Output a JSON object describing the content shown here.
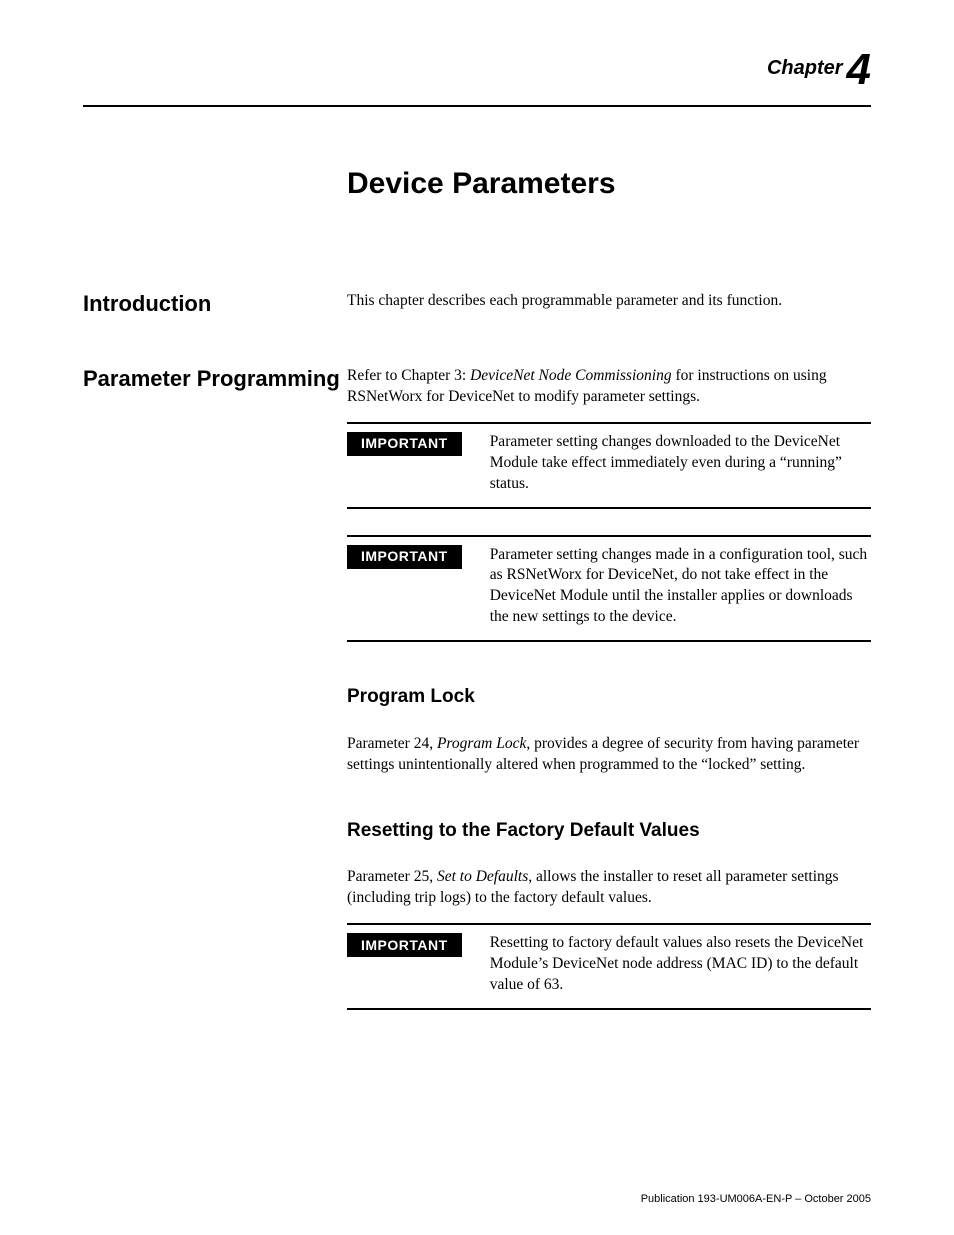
{
  "chapter": {
    "label": "Chapter",
    "number": "4"
  },
  "title": "Device Parameters",
  "sections": {
    "intro": {
      "heading": "Introduction",
      "body": "This chapter describes each programmable parameter and its function."
    },
    "paramProg": {
      "heading": "Parameter Programming",
      "body_pre": "Refer to Chapter 3: ",
      "body_italic": "DeviceNet Node Commissioning",
      "body_post": " for instructions on using RSNetWorx for DeviceNet to modify parameter settings.",
      "important1": {
        "label": "IMPORTANT",
        "text": "Parameter setting changes downloaded to the DeviceNet Module take effect immediately even during a “running” status."
      },
      "important2": {
        "label": "IMPORTANT",
        "text": "Parameter setting changes made in a configuration tool, such as RSNetWorx for DeviceNet, do not take effect in the DeviceNet Module until the installer applies or downloads the new settings to the device."
      }
    },
    "programLock": {
      "heading": "Program Lock",
      "body_pre": "Parameter 24, ",
      "body_italic": "Program Lock",
      "body_post": ", provides a degree of security from having parameter settings unintentionally altered when programmed to the “locked” setting."
    },
    "resetDefaults": {
      "heading": "Resetting to the Factory Default Values",
      "body_pre": "Parameter 25, ",
      "body_italic": "Set to Defaults",
      "body_post": ", allows the installer to reset all parameter settings (including trip logs) to the factory default values.",
      "important": {
        "label": "IMPORTANT",
        "text": "Resetting to factory default values also resets the DeviceNet Module’s DeviceNet node address (MAC ID) to the default value of 63."
      }
    }
  },
  "footer": "Publication 193-UM006A-EN-P – October 2005"
}
